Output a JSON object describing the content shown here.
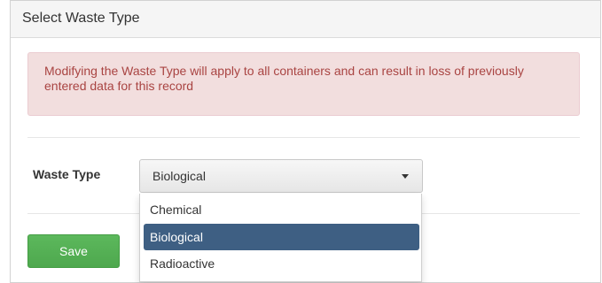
{
  "panel": {
    "title": "Select Waste Type"
  },
  "alert": {
    "message": "Modifying the Waste Type will apply to all containers and can result in loss of previously entered data for this record"
  },
  "form": {
    "waste_type_label": "Waste Type",
    "waste_type_value": "Biological",
    "options": [
      "Chemical",
      "Biological",
      "Radioactive"
    ],
    "highlighted_option": "Biological"
  },
  "actions": {
    "save_label": "Save"
  },
  "colors": {
    "alert_bg": "#f2dede",
    "alert_text": "#a94442",
    "save_button": "#5cb85c",
    "highlight": "#3e5f83"
  },
  "icons": {
    "select_caret": "caret-down-icon"
  }
}
